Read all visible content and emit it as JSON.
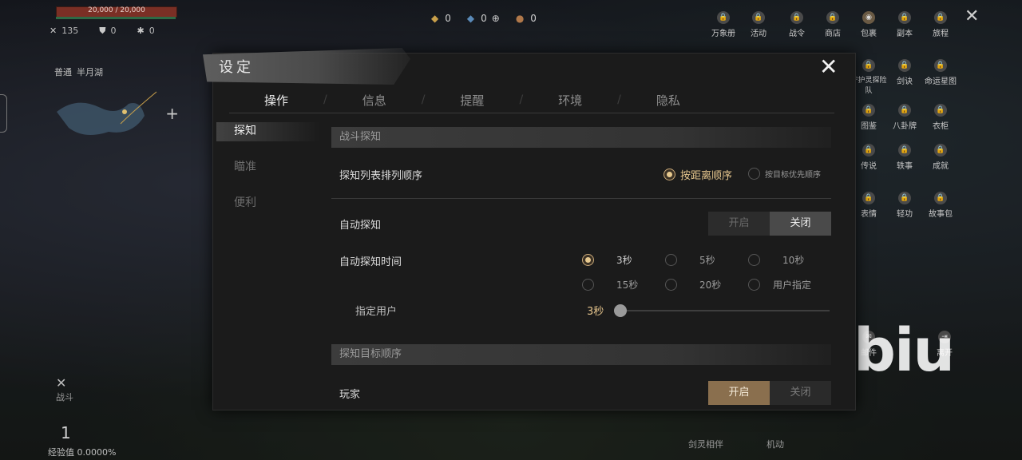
{
  "hud": {
    "hp": "20,000 / 20,000",
    "stats": [
      {
        "icon": "swords-icon",
        "glyph": "✕",
        "value": "135"
      },
      {
        "icon": "shield-icon",
        "glyph": "⛊",
        "value": "0"
      },
      {
        "icon": "sparkle-icon",
        "glyph": "✱",
        "value": "0"
      }
    ],
    "location_mode": "普通",
    "location_name": "半月湖",
    "currency": [
      {
        "icon": "gold-gem-icon",
        "glyph": "◆",
        "value": "0",
        "color": "#c9a04a"
      },
      {
        "icon": "blue-gem-icon",
        "glyph": "◆",
        "value": "0",
        "color": "#5a8ab8"
      },
      {
        "icon": "ore-icon",
        "glyph": "●",
        "value": "0",
        "color": "#b0784a"
      }
    ],
    "exp": "经验值 0.0000%",
    "level": "1",
    "bottom_labels": [
      "战斗",
      "剑灵相伴",
      "机动"
    ],
    "watermark": "biubiu"
  },
  "menu": [
    {
      "label": "万象册"
    },
    {
      "label": "活动"
    },
    {
      "label": "战令"
    },
    {
      "label": "商店"
    },
    {
      "label": "包裹"
    },
    {
      "label": "副本"
    },
    {
      "label": "旅程"
    },
    {
      "label": "守护灵探险队"
    },
    {
      "label": "剑诀"
    },
    {
      "label": "命运星图"
    },
    {
      "label": "图鉴"
    },
    {
      "label": "八卦牌"
    },
    {
      "label": "衣柜"
    },
    {
      "label": "传说"
    },
    {
      "label": "轶事"
    },
    {
      "label": "成就"
    },
    {
      "label": "表情"
    },
    {
      "label": "轻功"
    },
    {
      "label": "故事包"
    },
    {
      "label": "邮件"
    },
    {
      "label": "离开"
    }
  ],
  "dialog": {
    "title": "设定",
    "tabs": [
      "操作",
      "信息",
      "提醒",
      "环境",
      "隐私"
    ],
    "side": [
      "探知",
      "瞄准",
      "便利"
    ],
    "section1": "战斗探知",
    "sort_label": "探知列表排列顺序",
    "sort_opt1": "按距离顺序",
    "sort_opt2": "按目标优先顺序",
    "auto_label": "自动探知",
    "on": "开启",
    "off": "关闭",
    "time_label": "自动探知时间",
    "times": [
      "3秒",
      "5秒",
      "10秒",
      "15秒",
      "20秒",
      "用户指定"
    ],
    "custom_label": "指定用户",
    "custom_value": "3秒",
    "section2": "探知目标顺序",
    "player_label": "玩家"
  }
}
